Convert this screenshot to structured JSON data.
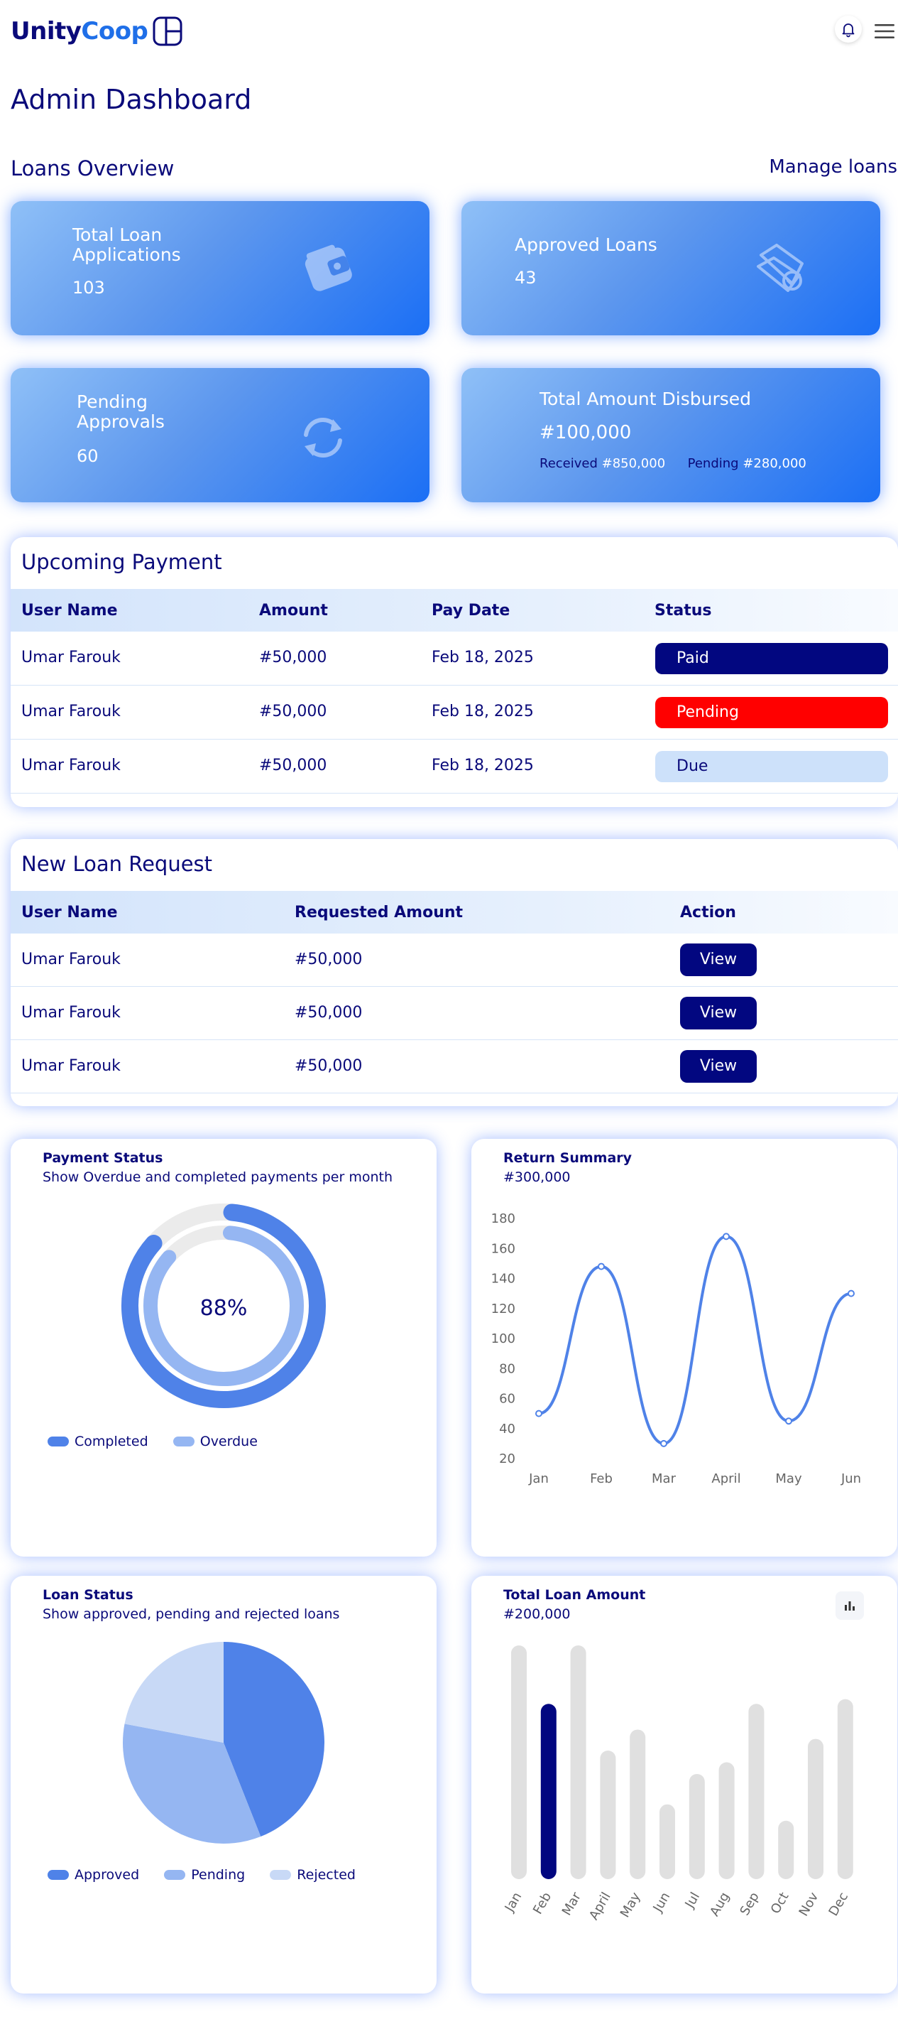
{
  "header": {
    "logo_part1": "Unity",
    "logo_part2": "Coop"
  },
  "page": {
    "title": "Admin Dashboard"
  },
  "loans_overview": {
    "title": "Loans Overview",
    "manage_link": "Manage loans",
    "cards": {
      "total_applications": {
        "label_line1": "Total Loan",
        "label_line2": "Applications",
        "value": "103"
      },
      "approved": {
        "label": "Approved Loans",
        "value": "43"
      },
      "pending": {
        "label_line1": "Pending",
        "label_line2": "Approvals",
        "value": "60"
      },
      "disbursed": {
        "label": "Total Amount Disbursed",
        "value": "#100,000",
        "received_label": "Received",
        "received_value": "#850,000",
        "pending_label": "Pending",
        "pending_value": "#280,000"
      }
    }
  },
  "upcoming_payment": {
    "title": "Upcoming Payment",
    "columns": [
      "User Name",
      "Amount",
      "Pay Date",
      "Status"
    ],
    "rows": [
      {
        "user": "Umar Farouk",
        "amount": "#50,000",
        "date": "Feb 18, 2025",
        "status": "Paid"
      },
      {
        "user": "Umar Farouk",
        "amount": "#50,000",
        "date": "Feb 18, 2025",
        "status": "Pending"
      },
      {
        "user": "Umar Farouk",
        "amount": "#50,000",
        "date": "Feb 18, 2025",
        "status": "Due"
      }
    ]
  },
  "new_loan_request": {
    "title": "New Loan Request",
    "columns": [
      "User Name",
      "Requested Amount",
      "Action"
    ],
    "rows": [
      {
        "user": "Umar Farouk",
        "amount": "#50,000",
        "action": "View"
      },
      {
        "user": "Umar Farouk",
        "amount": "#50,000",
        "action": "View"
      },
      {
        "user": "Umar Farouk",
        "amount": "#50,000",
        "action": "View"
      }
    ]
  },
  "payment_status": {
    "title": "Payment Status",
    "subtitle": "Show Overdue and completed payments per month",
    "center_label": "88%",
    "legend": [
      "Completed",
      "Overdue"
    ]
  },
  "return_summary": {
    "title": "Return Summary",
    "subtitle": "#300,000"
  },
  "loan_status": {
    "title": "Loan Status",
    "subtitle": "Show approved, pending and rejected loans",
    "legend": [
      "Approved",
      "Pending",
      "Rejected"
    ]
  },
  "total_loan_amount": {
    "title": "Total Loan Amount",
    "subtitle": "#200,000"
  },
  "colors": {
    "navy": "#0a0a7a",
    "accent": "#1b6ff5",
    "chart_blue": "#4f82e8",
    "chart_light": "#95b6f2",
    "chart_pale": "#c8d9f6",
    "bar_gray": "#e0e0e0",
    "bar_active": "#020780",
    "pending_red": "#ff0000"
  },
  "chart_data": [
    {
      "type": "pie",
      "variant": "donut",
      "labels": [
        "Completed",
        "Overdue"
      ],
      "values": [
        88,
        12
      ],
      "center_text": "88%"
    },
    {
      "type": "line",
      "x": [
        "Jan",
        "Feb",
        "Mar",
        "April",
        "May",
        "Jun"
      ],
      "series": [
        {
          "values": [
            50,
            148,
            30,
            168,
            45,
            130
          ]
        }
      ],
      "ylim": [
        20,
        180
      ],
      "yticks": [
        20,
        40,
        60,
        80,
        100,
        120,
        140,
        160,
        180
      ],
      "grid": false
    },
    {
      "type": "pie",
      "labels": [
        "Approved",
        "Pending",
        "Rejected"
      ],
      "values": [
        44,
        34,
        22
      ]
    },
    {
      "type": "bar",
      "categories": [
        "Jan",
        "Feb",
        "Mar",
        "April",
        "May",
        "Jun",
        "Jul",
        "Aug",
        "Sep",
        "Oct",
        "Nov",
        "Dec"
      ],
      "values": [
        100,
        75,
        100,
        55,
        64,
        32,
        45,
        50,
        75,
        25,
        60,
        77
      ],
      "highlighted": "Feb",
      "ylim": [
        0,
        100
      ]
    }
  ]
}
